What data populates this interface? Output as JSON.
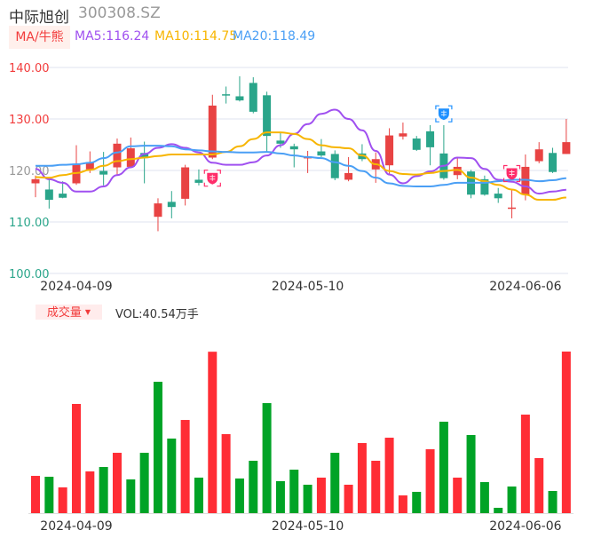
{
  "header": {
    "name": "中际旭创",
    "code": "300308.SZ",
    "indicator_tag": "MA/牛熊",
    "ma5_label": "MA5:116.24",
    "ma10_label": "MA10:114.75",
    "ma20_label": "MA20:118.49"
  },
  "volume_header": {
    "tag": "成交量",
    "tag_arrow": "▼",
    "value_label": "VOL:40.54万手"
  },
  "colors": {
    "up_candle": "#e84343",
    "down_candle": "#2aa58a",
    "up_volume": "#ff2d35",
    "down_volume": "#00a326",
    "ma5": "#a050f0",
    "ma10": "#f7b500",
    "ma20": "#4a9ff5",
    "bull_marker": "#ff2d6a",
    "bear_marker": "#1e90ff"
  },
  "chart_data": [
    {
      "type": "candlestick",
      "title": "中际旭创 300308.SZ",
      "ylim": [
        100,
        140
      ],
      "y_ticks": [
        {
          "value": 140,
          "label": "140.00",
          "tone": "up"
        },
        {
          "value": 130,
          "label": "130.00",
          "tone": "up"
        },
        {
          "value": 120,
          "label": "120.00",
          "tone": "flat"
        },
        {
          "value": 110,
          "label": "110.00",
          "tone": "down"
        },
        {
          "value": 100,
          "label": "100.00",
          "tone": "down"
        }
      ],
      "x_ticks": [
        {
          "index": 3,
          "label": "2024-04-09"
        },
        {
          "index": 20,
          "label": "2024-05-10"
        },
        {
          "index": 36,
          "label": "2024-06-06"
        }
      ],
      "ohlc": [
        [
          117.5,
          119.0,
          114.8,
          118.3
        ],
        [
          116.3,
          118.3,
          112.6,
          114.3
        ],
        [
          115.5,
          117.9,
          114.6,
          114.7
        ],
        [
          117.5,
          124.9,
          117.2,
          121.3
        ],
        [
          120.2,
          123.7,
          119.5,
          121.5
        ],
        [
          119.9,
          123.6,
          117.1,
          119.2
        ],
        [
          120.6,
          126.2,
          119.2,
          125.2
        ],
        [
          120.7,
          126.4,
          120.6,
          124.3
        ],
        [
          123.4,
          125.6,
          117.5,
          122.4
        ],
        [
          111.0,
          114.6,
          108.2,
          113.6
        ],
        [
          113.9,
          116.0,
          110.7,
          112.9
        ],
        [
          114.5,
          121.1,
          113.2,
          120.6
        ],
        [
          118.2,
          120.2,
          117.1,
          117.6
        ],
        [
          122.5,
          134.7,
          122.2,
          132.6
        ],
        [
          134.8,
          136.3,
          133.0,
          134.6
        ],
        [
          134.4,
          138.3,
          133.4,
          133.6
        ],
        [
          137.0,
          138.1,
          131.1,
          131.4
        ],
        [
          134.6,
          135.3,
          123.5,
          126.7
        ],
        [
          125.8,
          127.5,
          124.4,
          125.2
        ],
        [
          124.7,
          125.2,
          120.6,
          124.1
        ],
        [
          122.4,
          123.8,
          119.5,
          122.6
        ],
        [
          123.7,
          126.1,
          122.6,
          122.9
        ],
        [
          123.2,
          123.9,
          118.1,
          118.5
        ],
        [
          118.2,
          122.6,
          117.9,
          119.5
        ],
        [
          123.3,
          125.1,
          121.8,
          122.2
        ],
        [
          120.2,
          123.5,
          117.6,
          122.2
        ],
        [
          121.0,
          128.2,
          119.2,
          126.8
        ],
        [
          126.6,
          129.3,
          126.0,
          127.2
        ],
        [
          126.2,
          126.7,
          123.8,
          124.0
        ],
        [
          127.6,
          128.8,
          121.0,
          124.5
        ],
        [
          123.3,
          128.8,
          118.2,
          118.5
        ],
        [
          119.1,
          122.4,
          118.3,
          120.7
        ],
        [
          119.8,
          120.1,
          114.6,
          115.3
        ],
        [
          118.3,
          119.0,
          115.1,
          115.3
        ],
        [
          115.5,
          116.6,
          113.7,
          114.6
        ],
        [
          112.6,
          116.3,
          110.7,
          112.8
        ],
        [
          115.3,
          123.1,
          114.2,
          120.7
        ],
        [
          121.8,
          125.5,
          121.4,
          124.1
        ],
        [
          123.4,
          124.4,
          119.5,
          119.7
        ],
        [
          123.2,
          130.0,
          123.2,
          125.5
        ]
      ],
      "series": [
        {
          "name": "MA5",
          "values": [
            120.3,
            118.3,
            117.6,
            115.9,
            115.9,
            116.9,
            119.1,
            120.6,
            123.2,
            124.4,
            125.1,
            124.4,
            123.5,
            121.5,
            121.1,
            121.1,
            121.6,
            122.9,
            124.9,
            127.1,
            129.0,
            131.0,
            131.8,
            130.0,
            127.8,
            123.8,
            119.2,
            117.5,
            118.9,
            119.8,
            120.9,
            122.5,
            122.4,
            120.3,
            118.2,
            117.8,
            116.9,
            115.5,
            115.9,
            116.24
          ]
        },
        {
          "name": "MA10",
          "values": [
            118.7,
            118.6,
            119.1,
            119.5,
            120.1,
            120.9,
            121.8,
            122.2,
            122.5,
            122.8,
            123.1,
            123.1,
            123.1,
            123.1,
            123.6,
            124.7,
            126.1,
            127.4,
            127.4,
            127.1,
            126.1,
            124.9,
            124.5,
            124.3,
            122.9,
            121.2,
            119.9,
            119.3,
            119.2,
            119.5,
            119.9,
            120.1,
            118.6,
            117.9,
            117.2,
            116.3,
            115.3,
            114.3,
            114.3,
            114.75
          ]
        },
        {
          "name": "MA20",
          "values": [
            120.9,
            120.9,
            121.1,
            121.2,
            121.5,
            122.4,
            123.5,
            124.7,
            124.8,
            124.8,
            124.7,
            124.1,
            123.9,
            123.7,
            123.6,
            123.5,
            123.5,
            123.6,
            123.3,
            122.9,
            122.6,
            122.4,
            121.6,
            120.9,
            119.9,
            118.6,
            117.5,
            117.0,
            116.9,
            116.9,
            117.2,
            117.6,
            117.6,
            117.6,
            117.9,
            118.2,
            118.2,
            117.9,
            118.1,
            118.49
          ]
        }
      ],
      "markers": [
        {
          "index": 13,
          "type": "bull",
          "price": 118.5
        },
        {
          "index": 30,
          "type": "bear",
          "price": 131.0
        },
        {
          "index": 35,
          "type": "bull",
          "price": 119.4
        }
      ]
    },
    {
      "type": "bar",
      "title": "成交量",
      "unit": "万手",
      "ylim": [
        0,
        40.54
      ],
      "x_ticks": [
        {
          "index": 3,
          "label": "2024-04-09"
        },
        {
          "index": 20,
          "label": "2024-05-10"
        },
        {
          "index": 36,
          "label": "2024-06-06"
        }
      ],
      "values": [
        9.35,
        9.13,
        6.46,
        27.4,
        10.47,
        11.58,
        15.14,
        8.46,
        15.14,
        32.96,
        18.71,
        23.38,
        8.91,
        40.5,
        19.82,
        8.69,
        13.14,
        27.61,
        8.02,
        10.91,
        7.13,
        8.91,
        15.14,
        7.13,
        17.59,
        13.14,
        18.93,
        4.45,
        5.34,
        16.03,
        22.94,
        8.91,
        19.6,
        7.79,
        1.34,
        6.68,
        24.72,
        13.81,
        5.57,
        40.54
      ],
      "direction": [
        "up",
        "down",
        "up",
        "up",
        "up",
        "down",
        "up",
        "down",
        "down",
        "down",
        "down",
        "up",
        "down",
        "up",
        "up",
        "down",
        "down",
        "down",
        "down",
        "down",
        "down",
        "up",
        "down",
        "up",
        "up",
        "up",
        "up",
        "up",
        "down",
        "up",
        "down",
        "up",
        "down",
        "down",
        "down",
        "down",
        "up",
        "up",
        "down",
        "up"
      ]
    }
  ]
}
